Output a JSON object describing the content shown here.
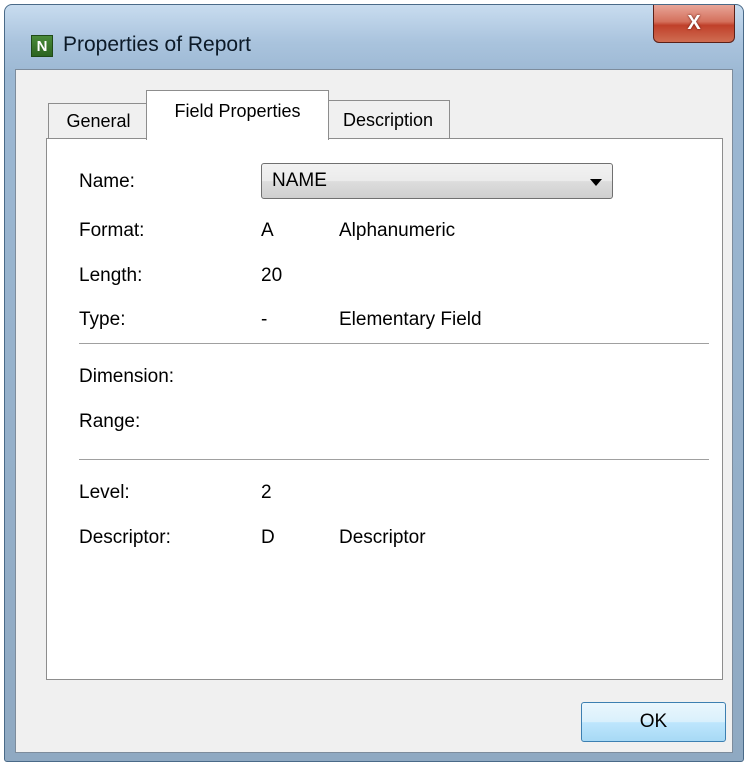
{
  "window": {
    "title": "Properties of Report",
    "app_icon_letter": "N",
    "close_glyph": "X",
    "colors": {
      "title_gradient_top": "#c8dcef",
      "close_button_red": "#c0402a"
    }
  },
  "tabs": [
    {
      "label": "General",
      "active": false
    },
    {
      "label": "Field Properties",
      "active": true
    },
    {
      "label": "Description",
      "active": false
    }
  ],
  "fields": {
    "name_label": "Name:",
    "name_value": "NAME",
    "format_label": "Format:",
    "format_code": "A",
    "format_desc": "Alphanumeric",
    "length_label": "Length:",
    "length_value": "20",
    "type_label": "Type:",
    "type_code": "-",
    "type_desc": "Elementary Field",
    "dimension_label": "Dimension:",
    "range_label": "Range:",
    "level_label": "Level:",
    "level_value": "2",
    "descriptor_label": "Descriptor:",
    "descriptor_code": "D",
    "descriptor_desc": "Descriptor"
  },
  "buttons": {
    "ok_label": "OK"
  },
  "icons": {
    "app": "natural-app-icon",
    "close": "close-icon",
    "dropdown": "chevron-down-icon"
  }
}
